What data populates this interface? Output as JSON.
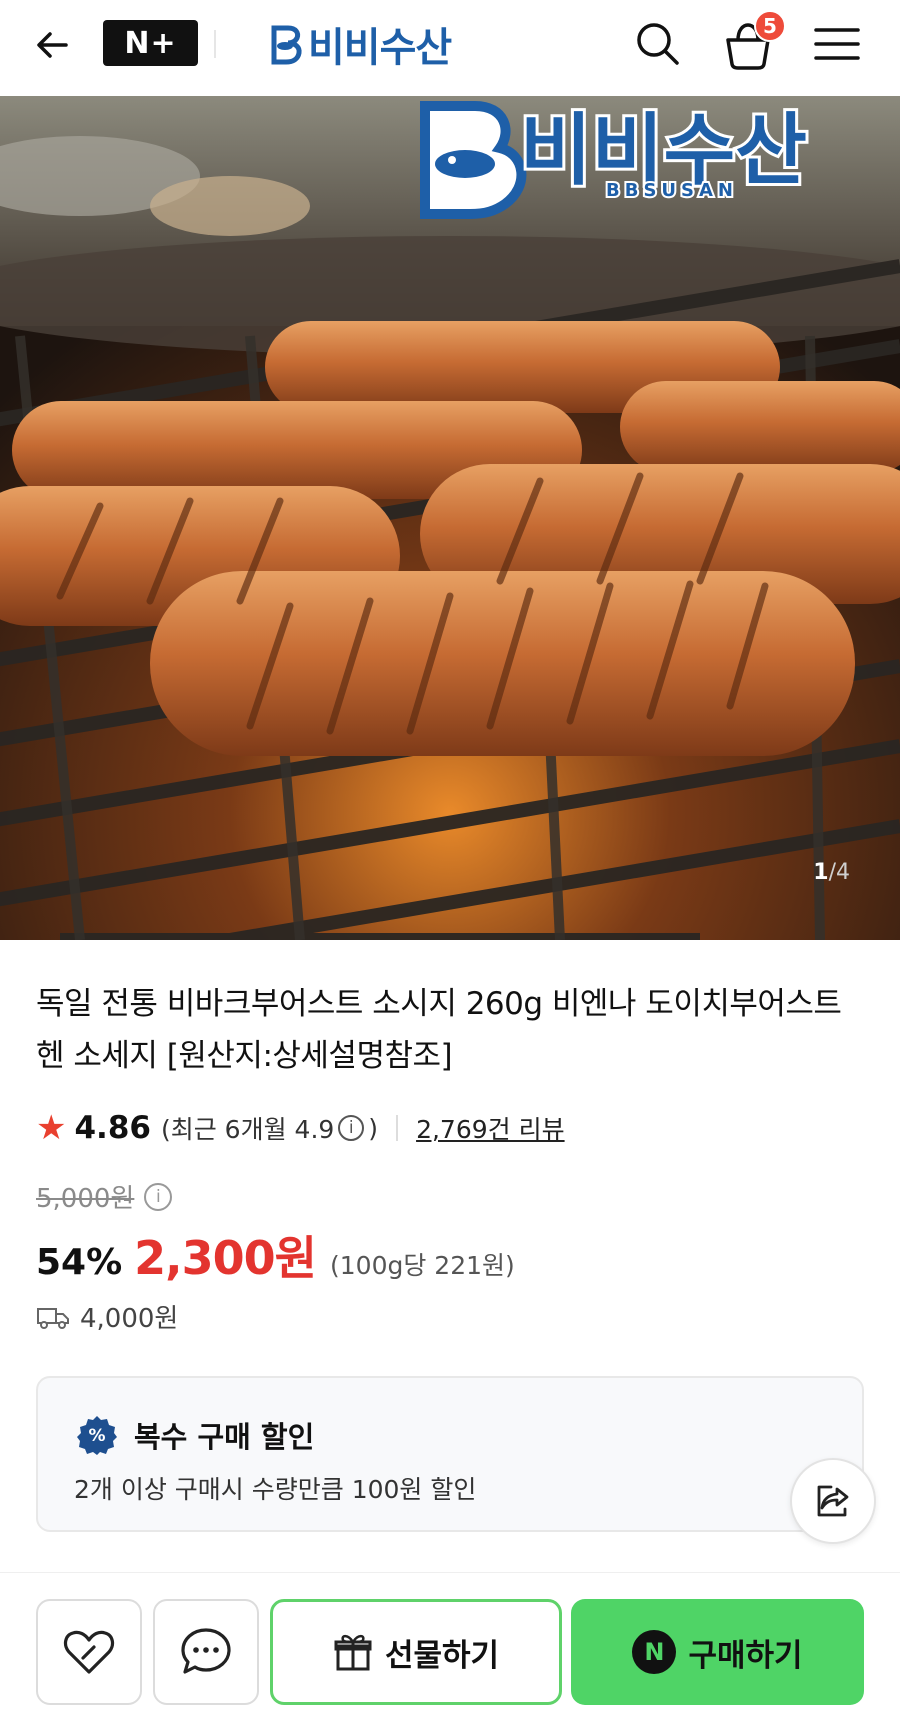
{
  "header": {
    "brand_badge": "N+",
    "store_name": "비비수산",
    "cart_count": "5"
  },
  "hero": {
    "logo_text": "비비수산",
    "logo_sub": "BBSUSAN",
    "pager_current": "1",
    "pager_total": "/4"
  },
  "product": {
    "title": "독일 전통 비바크부어스트 소시지 260g 비엔나 도이치부어스트 헨 소세지 [원산지:상세설명참조]",
    "rating": "4.86",
    "recent_rating_prefix": "(최근 6개월 4.9",
    "recent_rating_suffix": ")",
    "review_count": "2,769건 리뷰",
    "original_price": "5,000원",
    "discount_rate": "54%",
    "sale_price": "2,300원",
    "unit_price": "(100g당 221원)",
    "shipping_fee": "4,000원"
  },
  "discount_box": {
    "title": "복수 구매 할인",
    "description": "2개 이상 구매시 수량만큼 100원 할인"
  },
  "bottom_bar": {
    "gift_label": "선물하기",
    "buy_label": "구매하기",
    "buy_icon_letter": "N"
  },
  "colors": {
    "brand_blue": "#1e5fa8",
    "price_red": "#e3342f",
    "naver_green": "#4fd466",
    "badge_red": "#ee4b3a"
  },
  "icons": [
    "back-arrow-icon",
    "search-icon",
    "shopping-bag-icon",
    "hamburger-menu-icon",
    "star-icon",
    "info-icon",
    "delivery-truck-icon",
    "percent-badge-icon",
    "share-icon",
    "heart-icon",
    "chat-bubble-icon",
    "gift-icon"
  ]
}
